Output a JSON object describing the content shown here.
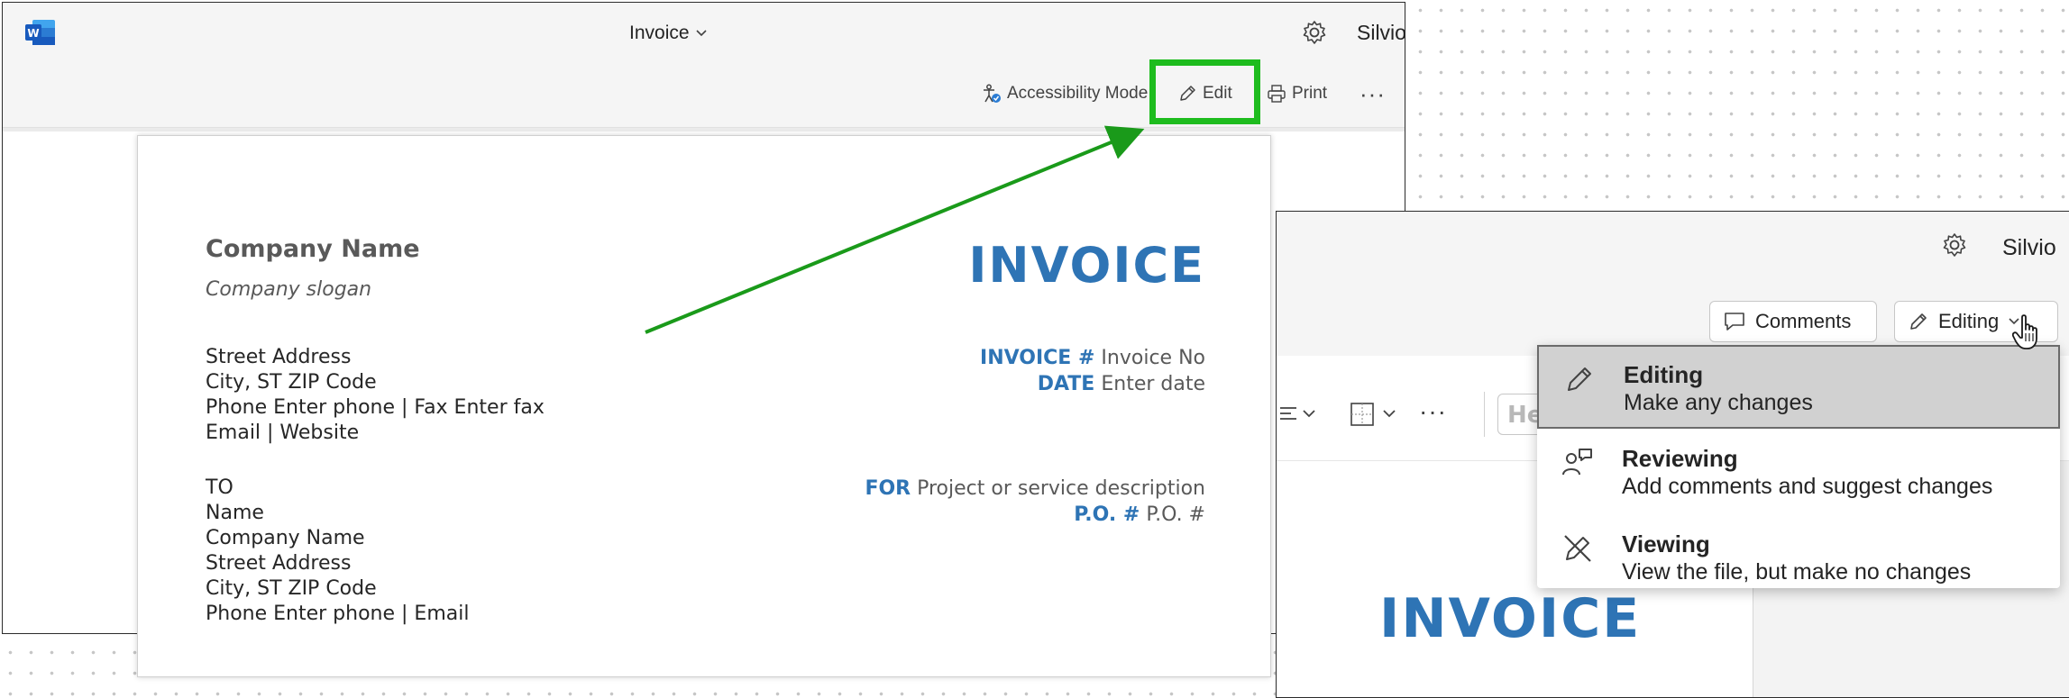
{
  "left_window": {
    "app_icon": "word-logo-icon",
    "title": "Invoice",
    "user": "Silvio",
    "commands": {
      "accessibility_label": "Accessibility Mode",
      "edit_label": "Edit",
      "print_label": "Print",
      "more_label": "···"
    },
    "document": {
      "company_name": "Company Name",
      "company_slogan": "Company slogan",
      "address_lines": [
        "Street Address",
        "City, ST ZIP Code",
        "Phone Enter phone | Fax Enter fax",
        "Email | Website"
      ],
      "to_lines": [
        "TO",
        "Name",
        "Company Name",
        "Street Address",
        "City, ST ZIP Code",
        "Phone Enter phone | Email"
      ],
      "heading": "INVOICE",
      "invoice_no_label": "INVOICE #",
      "invoice_no_value": "Invoice No",
      "date_label": "DATE",
      "date_value": "Enter date",
      "for_label": "FOR",
      "for_value": "Project or service description",
      "po_label": "P.O. #",
      "po_value": "P.O. #"
    }
  },
  "right_window": {
    "user": "Silvio",
    "comments_label": "Comments",
    "editing_label": "Editing",
    "ribbon_more": "···",
    "ribbon_partial_text": "He",
    "page_heading": "INVOICE",
    "mode_menu": [
      {
        "title": "Editing",
        "description": "Make any changes",
        "icon": "pencil-icon",
        "selected": true
      },
      {
        "title": "Reviewing",
        "description": "Add comments and suggest changes",
        "icon": "reviewing-icon",
        "selected": false
      },
      {
        "title": "Viewing",
        "description": "View the file, but make no changes",
        "icon": "pencil-slash-icon",
        "selected": false
      }
    ]
  },
  "colors": {
    "highlight": "#1ebc1e",
    "arrow": "#1a9a1a",
    "invoice_blue": "#2e74b5",
    "word_blue": "#185abd"
  }
}
